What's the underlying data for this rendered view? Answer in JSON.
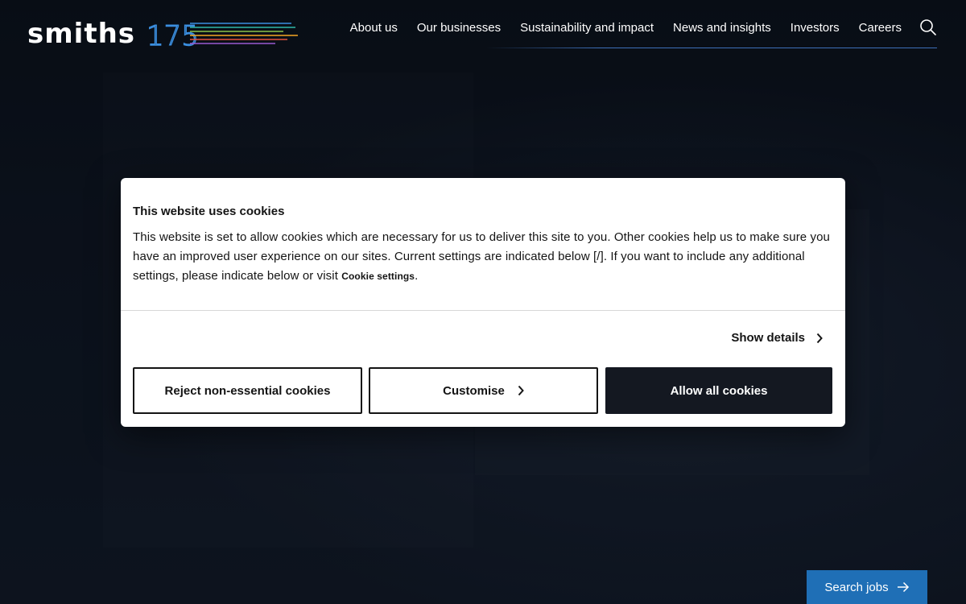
{
  "brand": {
    "name": "smiths",
    "anniversary": "175"
  },
  "nav": {
    "items": [
      {
        "label": "About us"
      },
      {
        "label": "Our businesses"
      },
      {
        "label": "Sustainability and impact"
      },
      {
        "label": "News and insights"
      },
      {
        "label": "Investors"
      },
      {
        "label": "Careers"
      }
    ],
    "search_icon": "search-icon"
  },
  "cookie_dialog": {
    "title": "This website uses cookies",
    "text_before_link": "This website is set to allow cookies which are necessary for us to deliver this site to you. Other cookies help us to make sure you have an improved user experience on our sites. Current settings are indicated below [/]. If you want to include any additional settings, please indicate below or visit ",
    "link_label": "Cookie settings",
    "text_after_link": ".",
    "show_details_label": "Show details",
    "reject_label": "Reject non-essential cookies",
    "customise_label": "Customise",
    "allow_label": "Allow all cookies"
  },
  "cta": {
    "search_jobs_label": "Search jobs"
  },
  "colors": {
    "page_background": "#0c131d",
    "accent_blue": "#1f6fb6",
    "dialog_dark_button": "#141821"
  }
}
